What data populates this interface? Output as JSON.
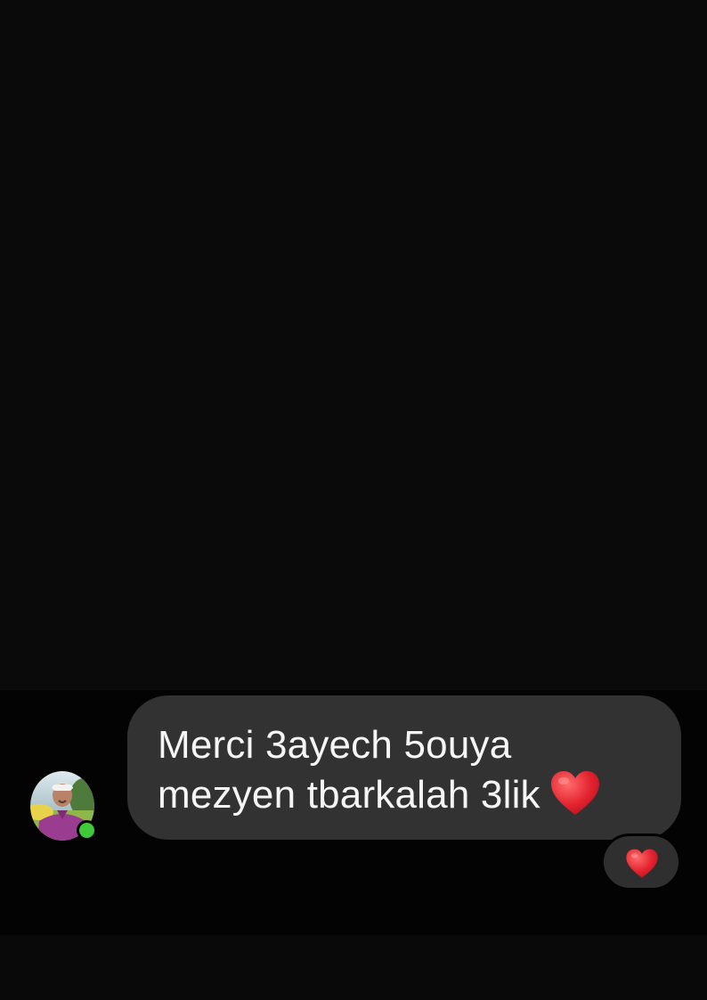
{
  "message": {
    "line1": "Merci 3ayech 5ouya",
    "line2": "mezyen tbarkalah 3lik",
    "emoji": "red-heart",
    "reaction": "red-heart"
  },
  "contact": {
    "online": true
  },
  "colors": {
    "background": "#0a0a0a",
    "bubble": "#323232",
    "text": "#f5f5f5",
    "heart": "#e3232f",
    "online": "#3fc93b"
  }
}
